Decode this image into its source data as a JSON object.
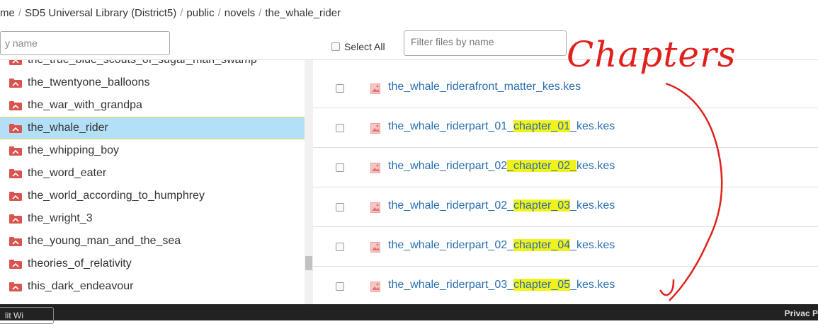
{
  "breadcrumb": {
    "items": [
      "me",
      "SD5 Universal Library (District5)",
      "public",
      "novels",
      "the_whale_rider"
    ],
    "separator": "/"
  },
  "left_filter": {
    "placeholder": "y name",
    "value": ""
  },
  "select_all": {
    "label": "Select All"
  },
  "right_filter": {
    "placeholder": "Filter files by name",
    "value": ""
  },
  "sidebar": {
    "items": [
      {
        "label": "the_true_blue_scouts_of_sugar_man_swamp",
        "selected": false
      },
      {
        "label": "the_twentyone_balloons",
        "selected": false
      },
      {
        "label": "the_war_with_grandpa",
        "selected": false
      },
      {
        "label": "the_whale_rider",
        "selected": true
      },
      {
        "label": "the_whipping_boy",
        "selected": false
      },
      {
        "label": "the_word_eater",
        "selected": false
      },
      {
        "label": "the_world_according_to_humphrey",
        "selected": false
      },
      {
        "label": "the_wright_3",
        "selected": false
      },
      {
        "label": "the_young_man_and_the_sea",
        "selected": false
      },
      {
        "label": "theories_of_relativity",
        "selected": false
      },
      {
        "label": "this_dark_endeavour",
        "selected": false
      }
    ]
  },
  "files": [
    {
      "pre": "the_whale_riderafront_matter_kes.kes",
      "hl": "",
      "post": ""
    },
    {
      "pre": "the_whale_riderpart_01_",
      "hl": "chapter_01",
      "post": "_kes.kes"
    },
    {
      "pre": "the_whale_riderpart_02",
      "hl": "_chapter_02_",
      "post": "kes.kes"
    },
    {
      "pre": "the_whale_riderpart_02_",
      "hl": "chapter_03",
      "post": "_kes.kes"
    },
    {
      "pre": "the_whale_riderpart_02_",
      "hl": "chapter_04",
      "post": "_kes.kes"
    },
    {
      "pre": "the_whale_riderpart_03_",
      "hl": "chapter_05",
      "post": "_kes.kes"
    }
  ],
  "annotation": {
    "text": "Chapters"
  },
  "footer": {
    "button_label": "lit Wi",
    "right_text": "Privac P"
  },
  "colors": {
    "link": "#2a6fb3",
    "highlight": "#f2f21b",
    "selected_bg": "#b3e0f7",
    "folder": "#d9534f",
    "annotation": "#e0201b",
    "footer": "#222222"
  },
  "icons": {
    "folder": "folder-icon",
    "file": "image-file-icon",
    "checkbox": "checkbox-icon"
  }
}
